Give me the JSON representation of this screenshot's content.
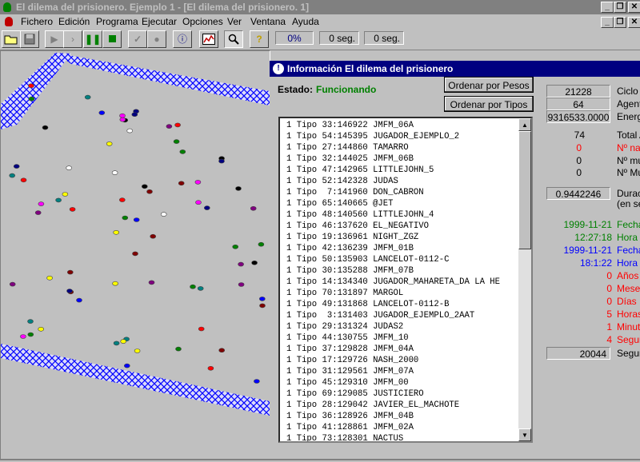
{
  "window": {
    "title": "El dilema del prisionero. Ejemplo 1 - [El dilema del prisionero. 1]",
    "controls": [
      "_",
      "❐",
      "✕"
    ],
    "inner_controls": [
      "_",
      "❐",
      "✕"
    ]
  },
  "menu": [
    "Fichero",
    "Edición",
    "Programa",
    "Ejecutar",
    "Opciones",
    "Ver",
    "Ventana",
    "Ayuda"
  ],
  "toolbar": {
    "progress": "0%",
    "time1": "0 seg.",
    "time2": "0 seg."
  },
  "info": {
    "title": "Información El dilema del prisionero",
    "estado_label": "Estado:",
    "estado_value": "Funcionando",
    "btn_pesos": "Ordenar por Pesos",
    "btn_tipos": "Ordenar por Tipos",
    "list": [
      "1 Tipo 33:146922 JMFM_06A",
      "1 Tipo 54:145395 JUGADOR_EJEMPLO_2",
      "1 Tipo 27:144860 TAMARRO",
      "1 Tipo 32:144025 JMFM_06B",
      "1 Tipo 47:142965 LITTLEJOHN_5",
      "1 Tipo 52:142328 JUDAS",
      "1 Tipo  7:141960 DON_CABRON",
      "1 Tipo 65:140665 @JET",
      "1 Tipo 48:140560 LITTLEJOHN_4",
      "1 Tipo 46:137620 EL_NEGATIVO",
      "1 Tipo 19:136961 NIGHT_ZGZ",
      "1 Tipo 42:136239 JMFM_01B",
      "1 Tipo 50:135903 LANCELOT-0112-C",
      "1 Tipo 30:135288 JMFM_07B",
      "1 Tipo 14:134340 JUGADOR_MAHARETA_DA LA HE",
      "1 Tipo 70:131897 MARGOL",
      "1 Tipo 49:131868 LANCELOT-0112-B",
      "1 Tipo  3:131403 JUGADOR_EJEMPLO_2AAT",
      "1 Tipo 29:131324 JUDAS2",
      "1 Tipo 44:130755 JMFM_10",
      "1 Tipo 37:129828 JMFM_04A",
      "1 Tipo 17:129726 NASH_2000",
      "1 Tipo 31:129561 JMFM_07A",
      "1 Tipo 45:129310 JMFM_00",
      "1 Tipo 69:129085 JUSTICIERO",
      "1 Tipo 28:129042 JAVIER_EL_MACHOTE",
      "1 Tipo 36:128926 JMFM_04B",
      "1 Tipo 41:128861 JMFM_02A",
      "1 Tipo 73:128301 NACTUS"
    ],
    "stats": {
      "ciclo_value": "21228",
      "ciclo_label": "Ciclo",
      "agentes_value": "64",
      "agentes_label": "Agent",
      "energia_value": "9316533.0000",
      "energia_label": "Energ",
      "total_value": "74",
      "total_label": "Total A",
      "nacidos_value": "0",
      "nacidos_label": "Nº nac",
      "muertos_value": "0",
      "muertos_label": "Nº mu",
      "mutados_value": "0",
      "mutados_label": "Nº Mu",
      "duracion_value": "0.9442246",
      "duracion_label": "Durac",
      "duracion_label2": "(en se",
      "fecha1_value": "1999-11-21",
      "fecha1_label": "Fecha",
      "hora1_value": "12:27:18",
      "hora1_label": "Hora",
      "fecha2_value": "1999-11-21",
      "fecha2_label": "Fecha",
      "hora2_value": "18:1:22",
      "hora2_label": "Hora F",
      "anos_value": "0",
      "anos_label": "Años",
      "meses_value": "0",
      "meses_label": "Meses",
      "dias_value": "0",
      "dias_label": "Días",
      "horas_value": "5",
      "horas_label": "Horas",
      "minutos_value": "1",
      "minutos_label": "Minuto",
      "segundos_value": "4",
      "segundos_label": "Segun",
      "seg_total_value": "20044",
      "seg_total_label": "Segur"
    }
  },
  "colors": {
    "green": "#008000",
    "red": "#ff0000",
    "blue": "#0000ff",
    "fence": "#0000ff",
    "titlebar_active": "#000080"
  },
  "agent_count": 74
}
